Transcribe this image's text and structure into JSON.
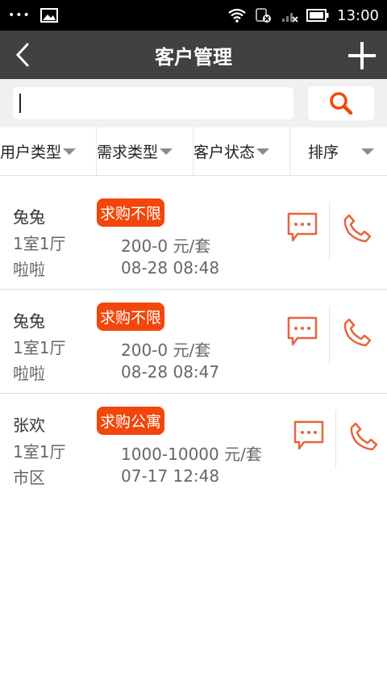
{
  "status_bar": {
    "time": "13:00",
    "dots": "•••"
  },
  "header": {
    "title": "客户管理"
  },
  "search": {
    "placeholder": ""
  },
  "filters": [
    {
      "label": "用户类型"
    },
    {
      "label": "需求类型"
    },
    {
      "label": "客户状态"
    },
    {
      "label": "排序"
    }
  ],
  "customers": [
    {
      "name": "兔兔",
      "room": "1室1厅",
      "area": "啦啦",
      "tag": "求购不限",
      "price": "200-0 元/套",
      "time": "08-28 08:48"
    },
    {
      "name": "兔兔",
      "room": "1室1厅",
      "area": "啦啦",
      "tag": "求购不限",
      "price": "200-0 元/套",
      "time": "08-28 08:47"
    },
    {
      "name": "张欢",
      "room": "1室1厅",
      "area": "市区",
      "tag": "求购公寓",
      "price": "1000-10000 元/套",
      "time": "07-17 12:48"
    }
  ],
  "colors": {
    "accent": "#f2460a",
    "header_bg": "#414141",
    "icon": "#e8643c"
  },
  "icons": {
    "back": "chevron-left-icon",
    "add": "plus-icon",
    "search": "search-icon",
    "message": "chat-bubble-icon",
    "phone": "phone-icon"
  }
}
